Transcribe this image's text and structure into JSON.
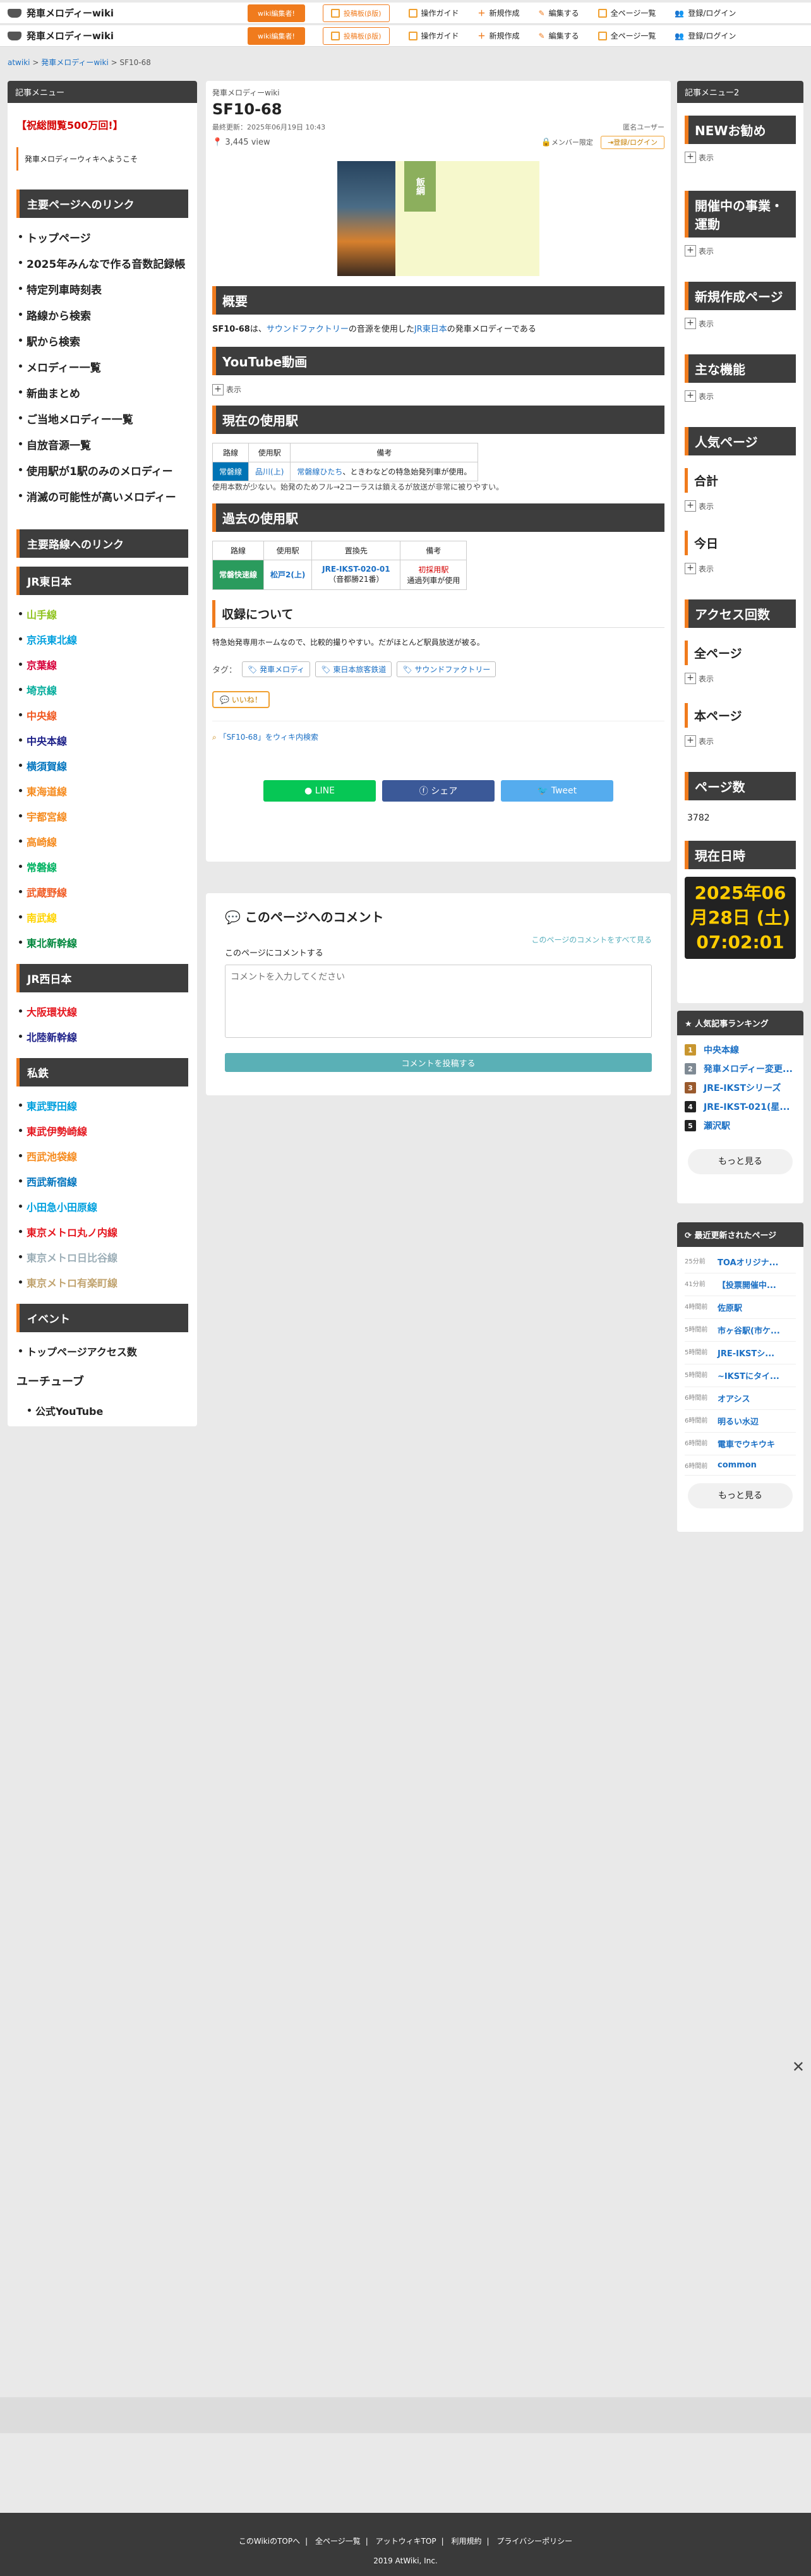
{
  "header": {
    "site_title": "発車メロディーwiki",
    "editor_recruit": "wiki編集者!",
    "entry_form": "投稿板(β版)",
    "nav": [
      "操作ガイド",
      "新規作成",
      "編集する",
      "全ページ一覧",
      "登録/ログイン"
    ]
  },
  "breadcrumb": [
    "atwiki",
    "発車メロディーwiki",
    "SF10-68"
  ],
  "left": {
    "menu_title": "記事メニュー",
    "views": "【祝総閲覧500万回!】",
    "welcome": "発車メロディーウィキへようこそ",
    "main_links_title": "主要ページへのリンク",
    "main_links": [
      "トップページ",
      "2025年みんなで作る音数記録帳",
      "特定列車時刻表",
      "路線から検索",
      "駅から検索",
      "メロディー一覧",
      "新曲まとめ",
      "ご当地メロディー一覧",
      "自放音源一覧",
      "使用駅が1駅のみのメロディー",
      "消滅の可能性が高いメロディー"
    ],
    "route_links_title": "主要路線へのリンク",
    "jr_east_title": "JR東日本",
    "jr_east": [
      {
        "name": "山手線",
        "color": "#8fc31f"
      },
      {
        "name": "京浜東北線",
        "color": "#00a0de"
      },
      {
        "name": "京葉線",
        "color": "#d7003a"
      },
      {
        "name": "埼京線",
        "color": "#00ac9b"
      },
      {
        "name": "中央線",
        "color": "#f15a22"
      },
      {
        "name": "中央本線",
        "color": "#1d2088"
      },
      {
        "name": "横須賀線",
        "color": "#0074be"
      },
      {
        "name": "東海道線",
        "color": "#f68b1e"
      },
      {
        "name": "宇都宮線",
        "color": "#f68b1e"
      },
      {
        "name": "高崎線",
        "color": "#f68b1e"
      },
      {
        "name": "常磐線",
        "color": "#00b261"
      },
      {
        "name": "武蔵野線",
        "color": "#f15a22"
      },
      {
        "name": "南武線",
        "color": "#ffd400"
      },
      {
        "name": "東北新幹線",
        "color": "#00873c"
      }
    ],
    "jr_west_title": "JR西日本",
    "jr_west": [
      {
        "name": "大阪環状線",
        "color": "#e5171f"
      },
      {
        "name": "北陸新幹線",
        "color": "#1d2088"
      }
    ],
    "private_title": "私鉄",
    "private": [
      {
        "name": "東武野田線",
        "color": "#00a0de"
      },
      {
        "name": "東武伊勢崎線",
        "color": "#e5171f"
      },
      {
        "name": "西武池袋線",
        "color": "#f68b1e"
      },
      {
        "name": "西武新宿線",
        "color": "#0074be"
      },
      {
        "name": "小田急小田原線",
        "color": "#00a0de"
      },
      {
        "name": "東京メトロ丸ノ内線",
        "color": "#e5171f"
      },
      {
        "name": "東京メトロ日比谷線",
        "color": "#9caeb7"
      },
      {
        "name": "東京メトロ有楽町線",
        "color": "#c1a470"
      }
    ],
    "event_title": "イベント",
    "event_items": [
      "トップページアクセス数"
    ],
    "youtube_head": "ユーチューブ",
    "youtube_items": [
      "公式YouTube"
    ]
  },
  "main": {
    "wiki_name": "発車メロディーwiki",
    "title": "SF10-68",
    "updated": "最終更新：2025年06月19日 10:43",
    "author": "匿名ユーザー",
    "view_count": "3,445",
    "view_label": "view",
    "member_limit": "メンバー限定",
    "login": "登録/ログイン",
    "hero_sign": "飯綱",
    "overview_title": "概要",
    "overview_1": "SF10-68",
    "overview_2": "は、",
    "overview_link1": "サウンドファクトリー",
    "overview_3": "の音源を使用した",
    "overview_link2": "JR東日本",
    "overview_4": "の発車メロディーである",
    "youtube_title": "YouTube動画",
    "show": "表示",
    "current_title": "現在の使用駅",
    "current_table": {
      "headers": [
        "路線",
        "使用駅",
        "備考"
      ],
      "line": "常磐線",
      "station": "品川(上)",
      "note_link": "常磐線ひたち",
      "note": "、ときわなどの特急始発列車が使用。"
    },
    "current_note": "使用本数が少ない。始発のためフル→2コーラスは鎖えるが放送が非常に被りやすい。",
    "past_title": "過去の使用駅",
    "past_table": {
      "headers": [
        "路線",
        "使用駅",
        "置換先",
        "備考"
      ],
      "line": "常磐快速線",
      "station": "松戸2(上)",
      "replace": "JRE-IKST-020-01",
      "replace_sub": "（音都勝21番）",
      "note_1": "初採用駅",
      "note_2": "通過列車が使用"
    },
    "recording_title": "収録について",
    "recording_text": "特急始発専用ホームなので、比較的撮りやすい。だがほとんど駅員放送が被る。",
    "tags_label": "タグ：",
    "tags": [
      "発車メロディ",
      "東日本旅客鉄道",
      "サウンドファクトリー"
    ],
    "nice": "いいね！",
    "search_text": "「SF10-68」をウィキ内検索",
    "share": {
      "line": "LINE",
      "facebook": "シェア",
      "twitter": "Tweet"
    }
  },
  "comment": {
    "title": "このページへのコメント",
    "all": "このページのコメントをすべて見る",
    "label": "このページにコメントする",
    "placeholder": "コメントを入力してください",
    "submit": "コメントを投稿する"
  },
  "right": {
    "menu_title": "記事メニュー2",
    "sec_new": "NEWお勧め",
    "sec_now": "開催中の事業・運動",
    "sec_create": "新規作成ページ",
    "sec_feature": "主な機能",
    "sec_popular": "人気ページ",
    "total": "合計",
    "today": "今日",
    "access_title": "アクセス回数",
    "all_pages": "全ページ",
    "this_page": "本ページ",
    "page_count_title": "ページ数",
    "page_count": "3782",
    "time_title": "現在日時",
    "clock": [
      "2025年06",
      "月28日 (土)",
      "07:02:01"
    ]
  },
  "ranking": {
    "title": "人気記事ランキング",
    "items": [
      {
        "n": "1",
        "name": "中央本線",
        "color": "#c8962f"
      },
      {
        "n": "2",
        "name": "発車メロディー変更...",
        "color": "#7f8a94"
      },
      {
        "n": "3",
        "name": "JRE-IKSTシリーズ",
        "color": "#9a5a2d"
      },
      {
        "n": "4",
        "name": "JRE-IKST-021(星...",
        "color": "#222"
      },
      {
        "n": "5",
        "name": "瀬沢駅",
        "color": "#222"
      }
    ],
    "more": "もっと見る"
  },
  "recent": {
    "title": "最近更新されたページ",
    "items": [
      {
        "t": "25分前",
        "s": "TOAオリジナ..."
      },
      {
        "t": "41分前",
        "s": "【投票開催中..."
      },
      {
        "t": "4時間前",
        "s": "佐原駅"
      },
      {
        "t": "5時間前",
        "s": "市ヶ谷駅(市ケ..."
      },
      {
        "t": "5時間前",
        "s": "JRE-IKSTシ..."
      },
      {
        "t": "5時間前",
        "s": "~IKSTにタイ..."
      },
      {
        "t": "6時間前",
        "s": "オアシス"
      },
      {
        "t": "6時間前",
        "s": "明るい水辺"
      },
      {
        "t": "6時間前",
        "s": "電車でウキウキ"
      },
      {
        "t": "6時間前",
        "s": "common"
      }
    ],
    "more": "もっと見る"
  },
  "footer": {
    "links": [
      "このWikiのTOPへ",
      "全ページ一覧",
      "アットウィキTOP",
      "利用規約",
      "プライバシーポリシー"
    ],
    "copy": "2019 AtWiki, Inc."
  }
}
